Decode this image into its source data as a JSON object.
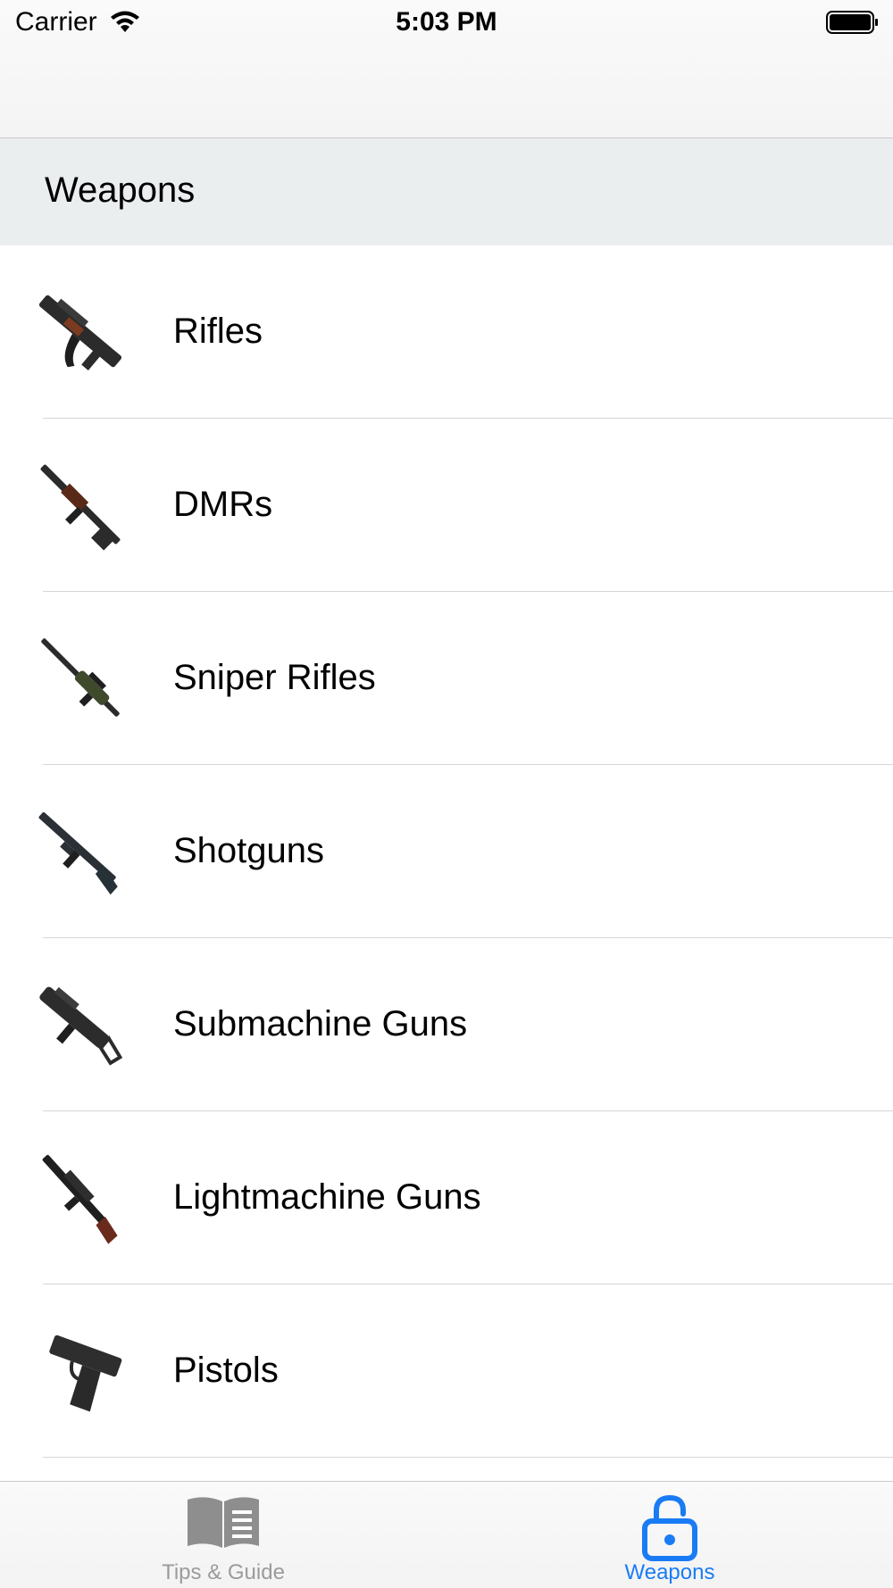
{
  "status_bar": {
    "carrier": "Carrier",
    "time": "5:03 PM"
  },
  "section": {
    "title": "Weapons"
  },
  "categories": [
    {
      "label": "Rifles",
      "icon": "assault-rifle-icon"
    },
    {
      "label": "DMRs",
      "icon": "dmr-icon"
    },
    {
      "label": "Sniper Rifles",
      "icon": "sniper-rifle-icon"
    },
    {
      "label": "Shotguns",
      "icon": "shotgun-icon"
    },
    {
      "label": "Submachine Guns",
      "icon": "submachine-gun-icon"
    },
    {
      "label": "Lightmachine Guns",
      "icon": "light-machine-gun-icon"
    },
    {
      "label": "Pistols",
      "icon": "pistol-icon"
    }
  ],
  "tabbar": {
    "tabs": [
      {
        "label": "Tips & Guide",
        "icon": "book-icon",
        "selected": false
      },
      {
        "label": "Weapons",
        "icon": "unlock-icon",
        "selected": true
      }
    ]
  },
  "colors": {
    "accent": "#1a7cf4",
    "inactive_tab": "#9b9b9b",
    "section_bg": "#ebeeef"
  }
}
